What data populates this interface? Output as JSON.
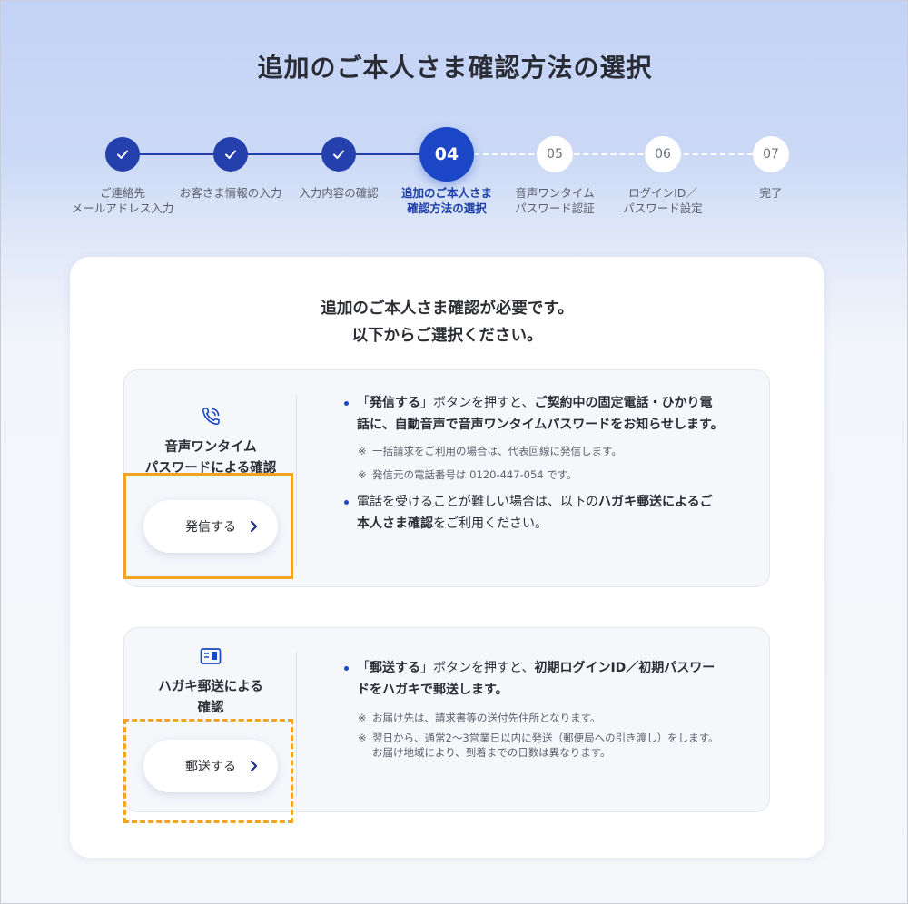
{
  "page_title": "追加のご本人さま確認方法の選択",
  "stepper": {
    "steps": [
      {
        "num": "",
        "state": "done",
        "label_l1": "ご連絡先",
        "label_l2": "メールアドレス入力"
      },
      {
        "num": "",
        "state": "done",
        "label_l1": "お客さま情報の入力",
        "label_l2": ""
      },
      {
        "num": "",
        "state": "done",
        "label_l1": "入力内容の確認",
        "label_l2": ""
      },
      {
        "num": "04",
        "state": "active",
        "label_l1": "追加のご本人さま",
        "label_l2": "確認方法の選択"
      },
      {
        "num": "05",
        "state": "todo",
        "label_l1": "音声ワンタイム",
        "label_l2": "パスワード認証"
      },
      {
        "num": "06",
        "state": "todo",
        "label_l1": "ログインID／",
        "label_l2": "パスワード設定"
      },
      {
        "num": "07",
        "state": "todo",
        "label_l1": "完了",
        "label_l2": ""
      }
    ]
  },
  "card": {
    "heading_l1": "追加のご本人さま確認が必要です。",
    "heading_l2": "以下からご選択ください。",
    "options": [
      {
        "icon": "phone-call-icon",
        "title_l1": "音声ワンタイム",
        "title_l2": "パスワードによる確認",
        "button_label": "発信する",
        "b1_p1": "「",
        "b1_bold1": "発信する",
        "b1_p2": "」ボタンを押すと、",
        "b1_bold2": "ご契約中の固定電話・ひかり電話に、自動音声で音声ワンタイムパスワードをお知らせします。",
        "note1_mark": "※",
        "note1": "一括請求をご利用の場合は、代表回線に発信します。",
        "note2_mark": "※",
        "note2": "発信元の電話番号は 0120-447-054 です。",
        "b2_p1": "電話を受けることが難しい場合は、以下の",
        "b2_bold1": "ハガキ郵送によるご本人さま確認",
        "b2_p2": "をご利用ください。"
      },
      {
        "icon": "postcard-icon",
        "title_l1": "ハガキ郵送による",
        "title_l2": "確認",
        "button_label": "郵送する",
        "b1_p1": "「",
        "b1_bold1": "郵送する",
        "b1_p2": "」ボタンを押すと、",
        "b1_bold2": "初期ログインID／初期パスワードをハガキで郵送します。",
        "note1_mark": "※",
        "note1": "お届け先は、請求書等の送付先住所となります。",
        "note2_mark": "※",
        "note2": "翌日から、通常2〜3営業日以内に発送（郵便局への引き渡し）をします。 お届け地域により、到着までの日数は異なります。"
      }
    ]
  },
  "colors": {
    "accent": "#1b46c6",
    "done": "#2340ac",
    "highlight": "#f0a422"
  }
}
